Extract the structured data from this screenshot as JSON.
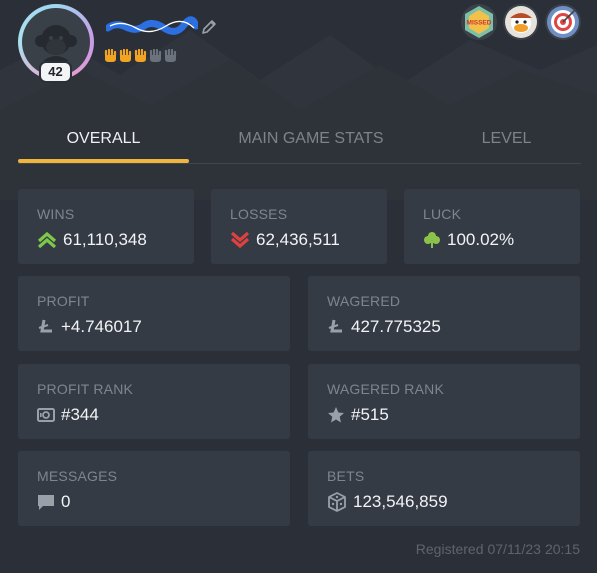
{
  "profile": {
    "level": "42"
  },
  "tabs": [
    "OVERALL",
    "MAIN GAME STATS",
    "LEVEL"
  ],
  "badges": {
    "missed_text": "MISSED"
  },
  "stats": {
    "wins": {
      "label": "WINS",
      "value": "61,110,348"
    },
    "losses": {
      "label": "LOSSES",
      "value": "62,436,511"
    },
    "luck": {
      "label": "LUCK",
      "value": "100.02%"
    },
    "profit": {
      "label": "PROFIT",
      "value": "+4.746017"
    },
    "wagered": {
      "label": "WAGERED",
      "value": "427.775325"
    },
    "profit_rank": {
      "label": "PROFIT RANK",
      "value": "#344"
    },
    "wagered_rank": {
      "label": "WAGERED RANK",
      "value": "#515"
    },
    "messages": {
      "label": "MESSAGES",
      "value": "0"
    },
    "bets": {
      "label": "BETS",
      "value": "123,546,859"
    }
  },
  "footer": {
    "registered_label": "Registered",
    "date": "07/11/23",
    "time": "20:15"
  },
  "colors": {
    "accent": "#f1b53c",
    "wins": "#7ec84a",
    "losses": "#e0413f",
    "luck": "#8bc34a"
  }
}
